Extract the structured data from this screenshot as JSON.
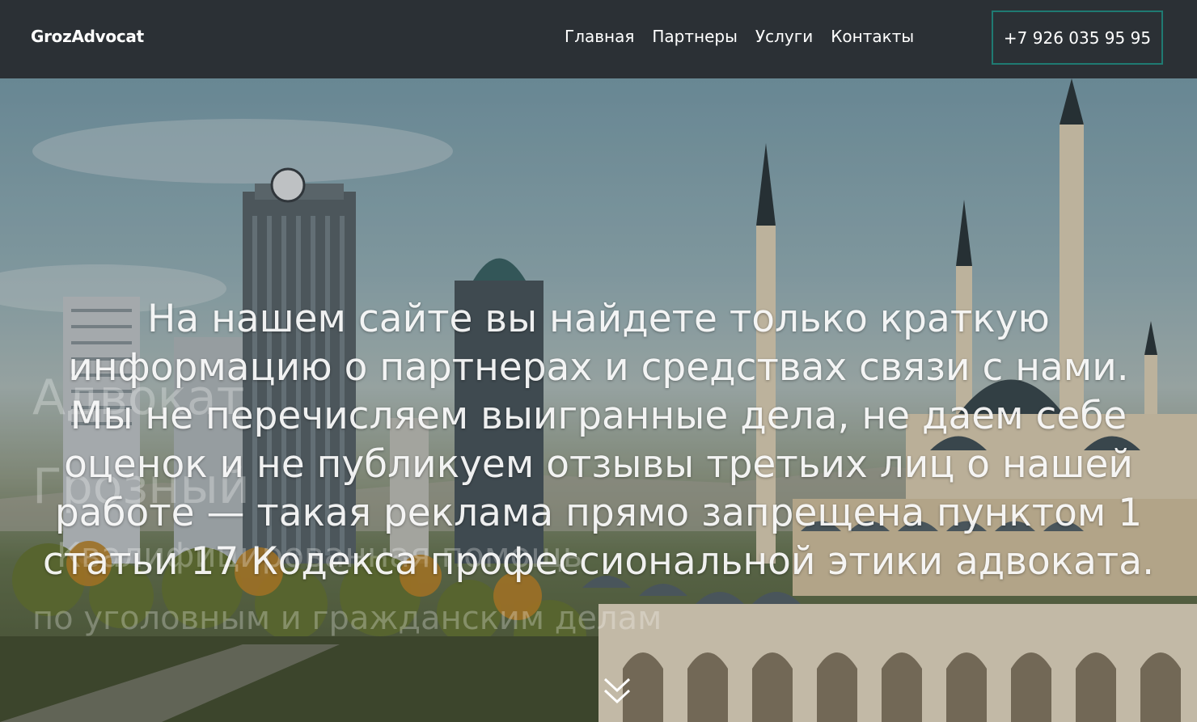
{
  "navbar": {
    "brand": "GrozAdvocat",
    "links": [
      "Главная",
      "Партнеры",
      "Услуги",
      "Контакты"
    ],
    "phone": "+7 926 035 95 95"
  },
  "hero": {
    "ghost_lines": [
      "Адвокат",
      "Грозный",
      "Квалифицированная помощь",
      "по уголовным и гражданским делам"
    ],
    "message": "На нашем сайте вы найдете только краткую информацию о партнерах и средствах связи с нами. Мы не перечисляем выигранные дела, не даем себе оценок и не публикуем отзывы третьих лиц о нашей работе — такая реклама прямо запрещена пунктом 1 статьи 17 Кодекса профессиональной этики адвоката.",
    "scroll_icon": "double-chevron-down-icon"
  },
  "colors": {
    "navbar_bg": "#2b3035",
    "phone_border": "#1f7a72",
    "text": "#ffffff"
  }
}
